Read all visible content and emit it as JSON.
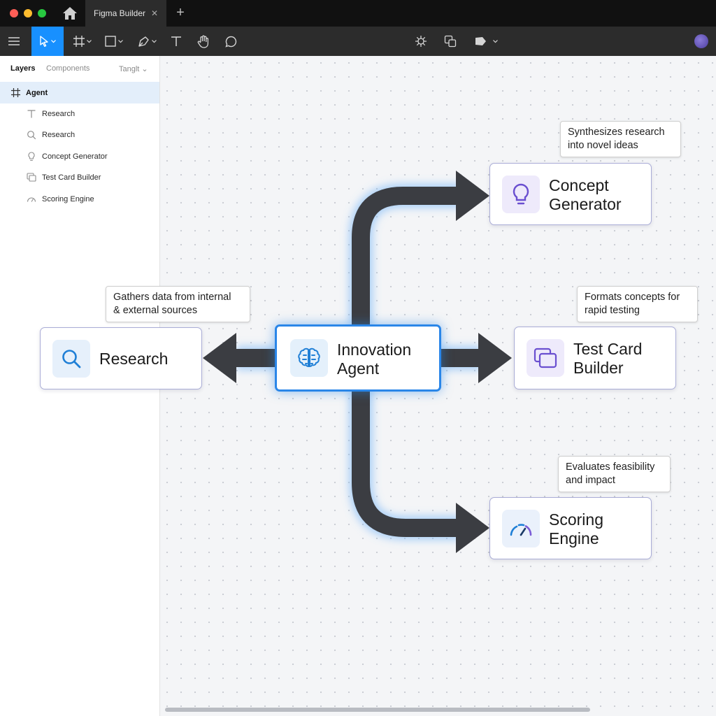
{
  "titlebar": {
    "tab_title": "Figma Builder",
    "tab_close": "✕",
    "new_tab": "+"
  },
  "toolbar": {
    "icons": [
      "menu-icon",
      "move-tool-icon",
      "frame-tool-icon",
      "shape-tool-icon",
      "pen-tool-icon",
      "text-tool-icon",
      "hand-tool-icon",
      "comment-tool-icon",
      "plugins-icon",
      "components-icon",
      "tag-icon"
    ],
    "accent": "#1890ff"
  },
  "panel": {
    "tabs": {
      "layers": "Layers",
      "components": "Components",
      "page": "Tanglt ⌄"
    },
    "layers": [
      {
        "label": "Agent",
        "icon": "frame-icon"
      },
      {
        "label": "Research",
        "icon": "text-icon"
      },
      {
        "label": "Research",
        "icon": "search-icon"
      },
      {
        "label": "Concept Generator",
        "icon": "lightbulb-icon"
      },
      {
        "label": "Test Card Builder",
        "icon": "cards-icon"
      },
      {
        "label": "Scoring Engine",
        "icon": "gauge-icon"
      }
    ]
  },
  "diagram": {
    "center": {
      "line1": "Innovation",
      "line2": "Agent",
      "icon": "brain-icon"
    },
    "nodes": {
      "research": {
        "title": "Research",
        "icon": "search-icon",
        "note_line1": "Gathers data from internal",
        "note_line2": "& external sources"
      },
      "concept": {
        "line1": "Concept",
        "line2": "Generator",
        "icon": "lightbulb-icon",
        "note_line1": "Synthesizes research",
        "note_line2": "into novel ideas"
      },
      "testcard": {
        "line1": "Test Card",
        "line2": "Builder",
        "icon": "cards-icon",
        "note_line1": "Formats concepts for",
        "note_line2": "rapid testing"
      },
      "scoring": {
        "line1": "Scoring",
        "line2": "Engine",
        "icon": "gauge-icon",
        "note_line1": "Evaluates feasibility",
        "note_line2": "and impact"
      }
    },
    "colors": {
      "center_border": "#2a86e8",
      "node_border": "#a9acd6",
      "arrow": "#3b3d42",
      "glow": "#6aaef5"
    }
  }
}
